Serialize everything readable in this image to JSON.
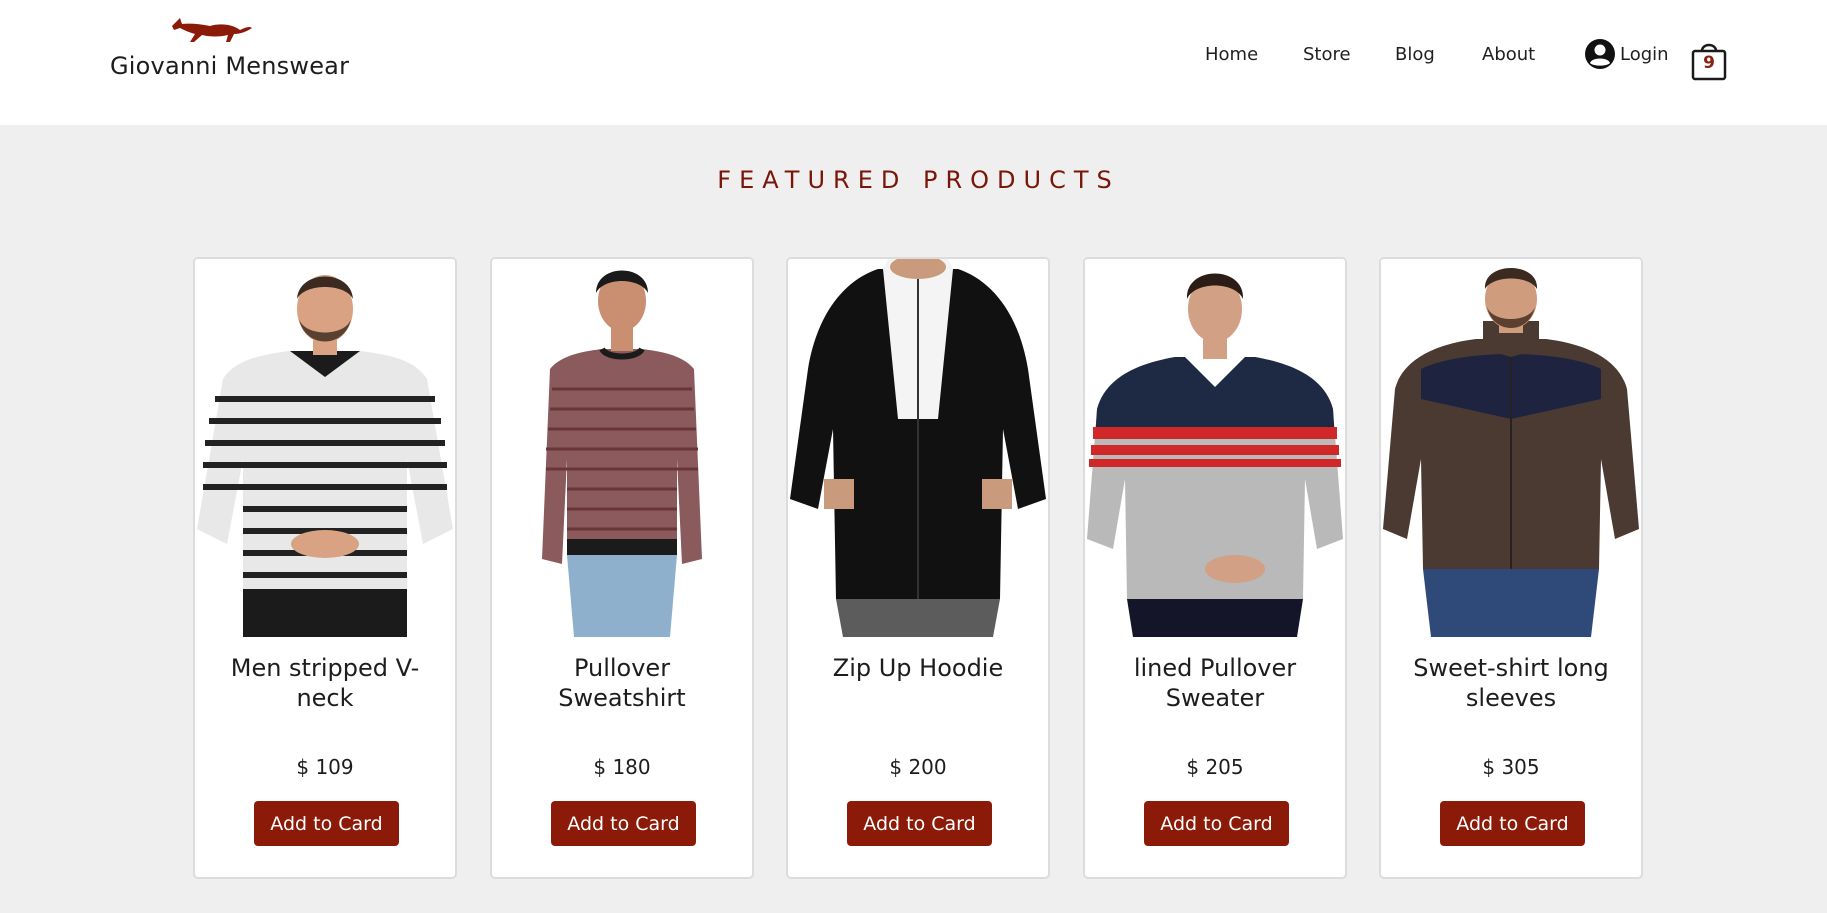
{
  "header": {
    "brand_name": "Giovanni Menswear",
    "nav": [
      {
        "label": "Home"
      },
      {
        "label": "Store"
      },
      {
        "label": "Blog"
      },
      {
        "label": "About"
      }
    ],
    "login_label": "Login",
    "cart_count": "9",
    "icons": {
      "logo": "fox-logo-icon",
      "login": "user-circle-icon",
      "cart": "shopping-bag-icon"
    }
  },
  "section": {
    "title": "FEATURED PRODUCTS"
  },
  "products": [
    {
      "name": "Men stripped V-neck",
      "price": "$ 109",
      "button": "Add to Card",
      "image": "striped-v-neck-sweater-photo"
    },
    {
      "name": "Pullover Sweatshirt",
      "price": "$ 180",
      "button": "Add to Card",
      "image": "striped-pullover-photo"
    },
    {
      "name": "Zip Up Hoodie",
      "price": "$ 200",
      "button": "Add to Card",
      "image": "black-zip-hoodie-photo"
    },
    {
      "name": "lined Pullover Sweater",
      "price": "$ 205",
      "button": "Add to Card",
      "image": "lined-pullover-photo"
    },
    {
      "name": "Sweet-shirt long sleeves",
      "price": "$ 305",
      "button": "Add to Card",
      "image": "brown-zip-sweatshirt-photo"
    }
  ],
  "colors": {
    "accent": "#8b1a08",
    "title": "#7a1608",
    "page_bg": "#efefef",
    "header_bg": "#ffffff"
  }
}
